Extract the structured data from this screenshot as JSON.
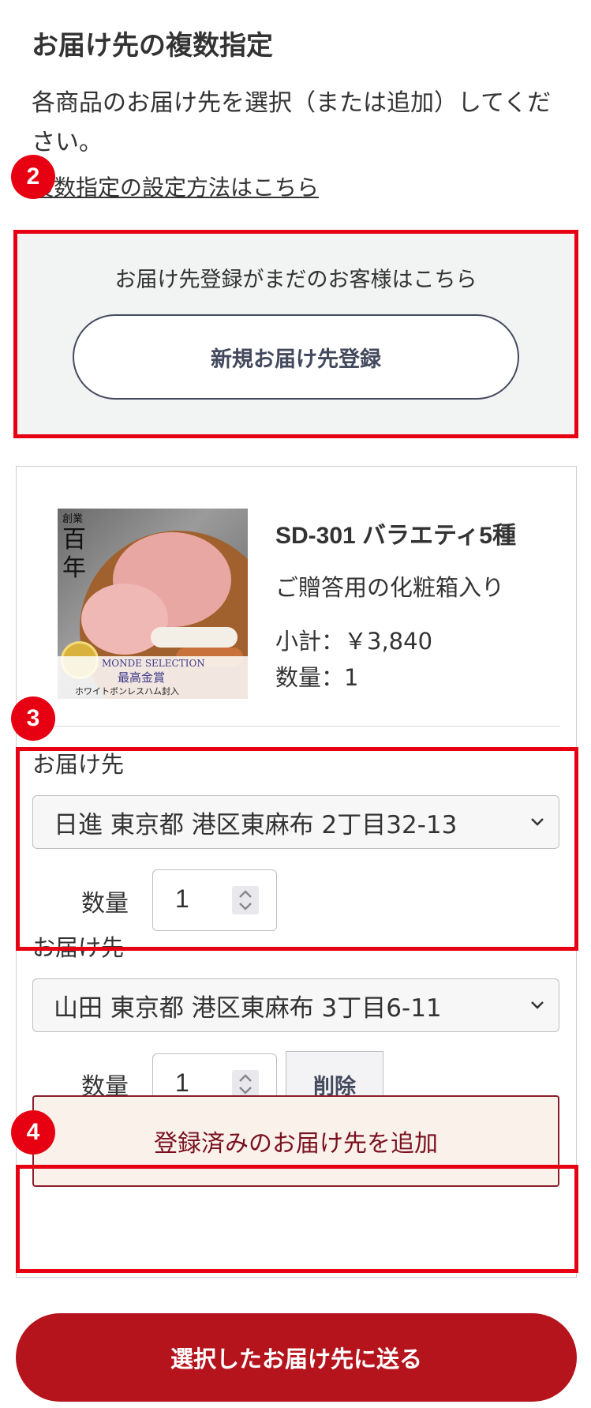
{
  "page": {
    "title": "お届け先の複数指定",
    "intro": "各商品のお届け先を選択（または追加）してください。",
    "help_link": "複数指定の設定方法はこちら"
  },
  "steps": {
    "two": "2",
    "three": "3",
    "four": "4"
  },
  "register": {
    "note": "お届け先登録がまだのお客様はこちら",
    "button": "新規お届け先登録"
  },
  "product": {
    "image_text": {
      "vertical_small": "創業",
      "vertical_large_1": "百",
      "vertical_large_2": "年",
      "band_1": "MONDE SELECTION",
      "band_2": "最高金賞",
      "band_3": "ホワイトボンレスハム封入"
    },
    "name": "SD-301 バラエティ5種",
    "description": "ご贈答用の化粧箱入り",
    "subtotal": "小計：￥3,840",
    "quantity": "数量：1"
  },
  "destinations": [
    {
      "label": "お届け先",
      "address": "日進 東京都 港区東麻布 2丁目32-13",
      "qty_label": "数量",
      "qty": "1"
    },
    {
      "label": "お届け先",
      "address": "山田 東京都 港区東麻布 3丁目6-11",
      "qty_label": "数量",
      "qty": "1",
      "delete": "削除"
    }
  ],
  "add_destination": "登録済みのお届け先を追加",
  "submit": "選択したお届け先に送る",
  "colors": {
    "highlight": "#e60012",
    "submit": "#b5141c",
    "add_border": "#8b1d2c",
    "add_bg": "#faf2ea",
    "register_bg": "#f2f3f3"
  }
}
